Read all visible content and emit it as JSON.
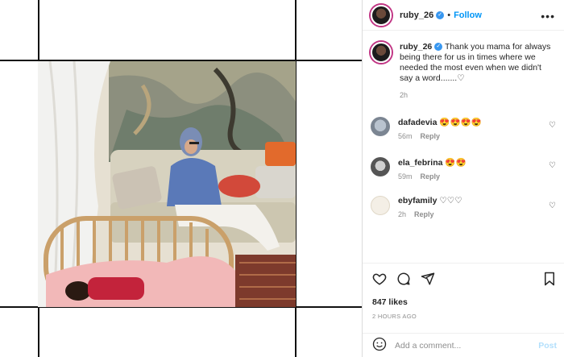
{
  "post": {
    "username": "ruby_26",
    "verified_mark": "✓",
    "separator": "•",
    "follow_label": "Follow",
    "more_label": "•••",
    "caption": "Thank you mama for always being there for us in times where we needed the most even when we didn't say a word.......♡",
    "caption_time": "2h"
  },
  "comments": [
    {
      "username": "dafadevia",
      "text": "😍😍😍😍",
      "time": "56m",
      "reply_label": "Reply",
      "avatar_icon": "user-avatar"
    },
    {
      "username": "ela_febrina",
      "text": "😍😍",
      "time": "59m",
      "reply_label": "Reply",
      "avatar_icon": "user-avatar"
    },
    {
      "username": "ebyfamily",
      "text": "♡♡♡",
      "time": "2h",
      "reply_label": "Reply",
      "avatar_icon": "brand-avatar"
    }
  ],
  "actions": {
    "likes": "847 likes",
    "ago": "2 HOURS AGO",
    "comment_placeholder": "Add a comment...",
    "post_label": "Post",
    "icons": [
      "heart-icon",
      "comment-icon",
      "share-icon",
      "bookmark-icon",
      "emoji-icon"
    ]
  },
  "colors": {
    "accent": "#0095f6",
    "verified": "#3897f0",
    "muted": "#8e8e8e",
    "post_disabled": "#b2dffc"
  }
}
